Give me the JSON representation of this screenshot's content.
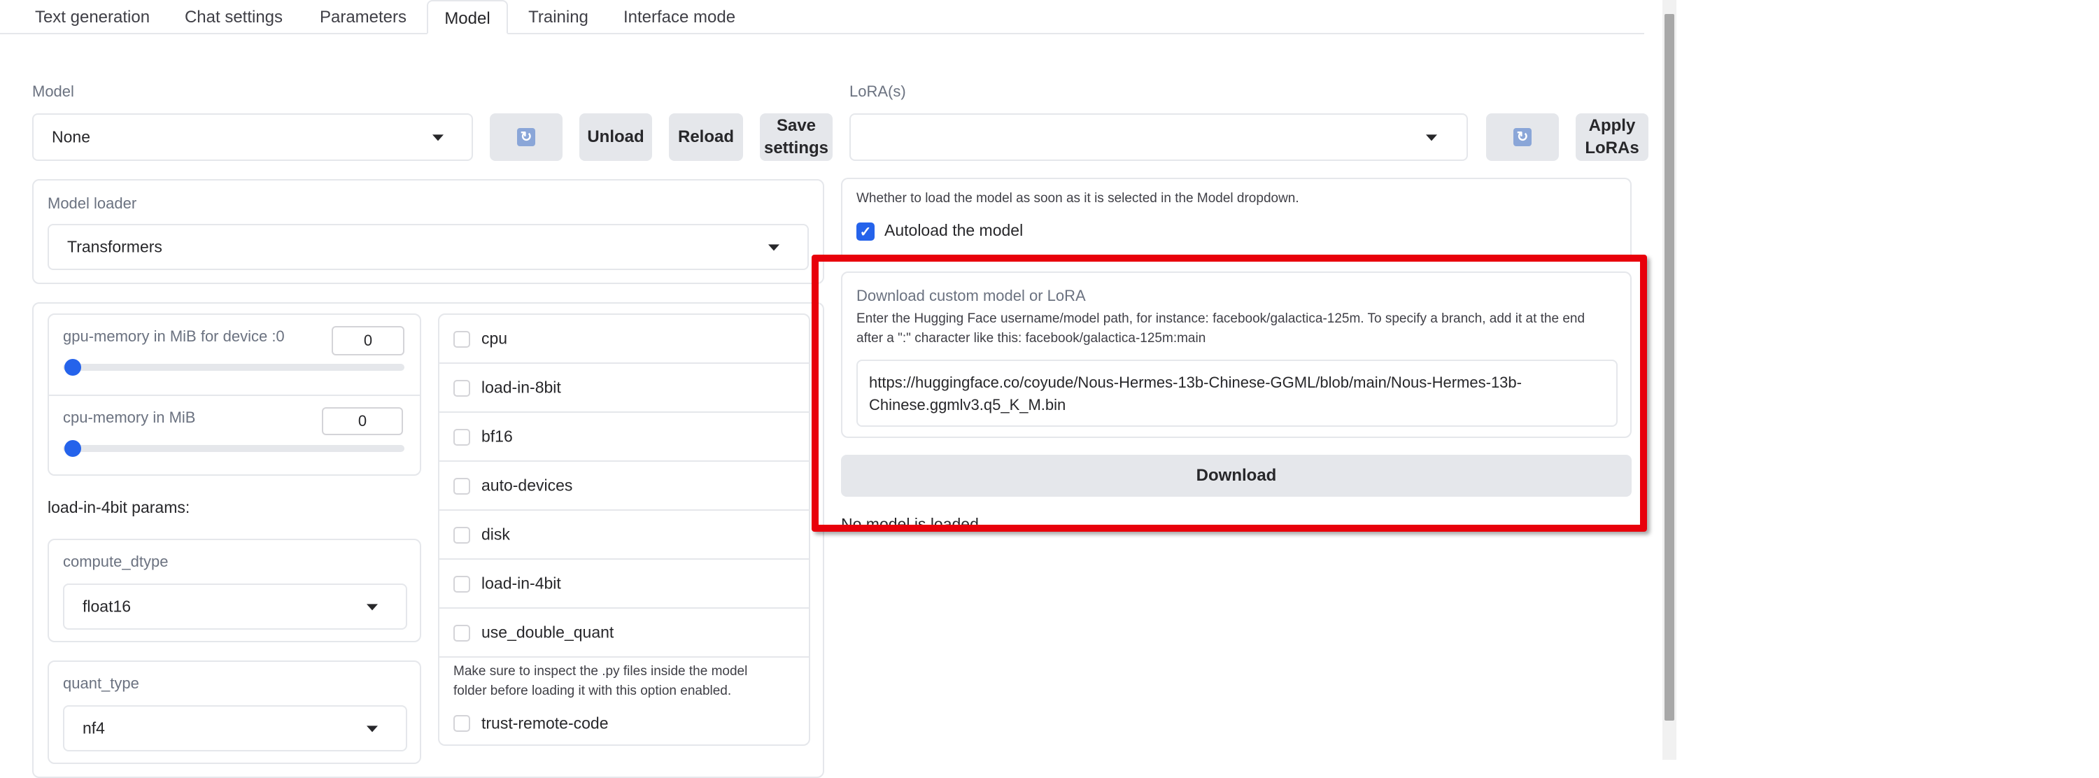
{
  "tabs": [
    {
      "label": "Text generation"
    },
    {
      "label": "Chat settings"
    },
    {
      "label": "Parameters"
    },
    {
      "label": "Model"
    },
    {
      "label": "Training"
    },
    {
      "label": "Interface mode"
    }
  ],
  "model": {
    "label": "Model",
    "selected": "None",
    "unload_label": "Unload",
    "reload_label": "Reload",
    "save_label_line1": "Save",
    "save_label_line2": "settings"
  },
  "lora": {
    "label": "LoRA(s)",
    "selected": "",
    "apply_label_line1": "Apply",
    "apply_label_line2": "LoRAs"
  },
  "loader": {
    "label": "Model loader",
    "selected": "Transformers"
  },
  "gpu_memory": {
    "label": "gpu-memory in MiB for device :0",
    "value": "0",
    "level": 0
  },
  "cpu_memory": {
    "label": "cpu-memory in MiB",
    "value": "0",
    "level": 0
  },
  "fourbit": {
    "heading": "load-in-4bit params:",
    "compute_dtype_label": "compute_dtype",
    "compute_dtype_value": "float16",
    "quant_type_label": "quant_type",
    "quant_type_value": "nf4"
  },
  "checkboxes": [
    {
      "label": "cpu",
      "checked": false
    },
    {
      "label": "load-in-8bit",
      "checked": false
    },
    {
      "label": "bf16",
      "checked": false
    },
    {
      "label": "auto-devices",
      "checked": false
    },
    {
      "label": "disk",
      "checked": false
    },
    {
      "label": "load-in-4bit",
      "checked": false
    },
    {
      "label": "use_double_quant",
      "checked": false
    }
  ],
  "trust_note_line1": "Make sure to inspect the .py files inside the model",
  "trust_note_line2": "folder before loading it with this option enabled.",
  "trust_remote_code": {
    "label": "trust-remote-code",
    "checked": false
  },
  "autoload": {
    "info": "Whether to load the model as soon as it is selected in the Model dropdown.",
    "label": "Autoload the model",
    "checked": true
  },
  "download": {
    "title": "Download custom model or LoRA",
    "help_line1": "Enter the Hugging Face username/model path, for instance: facebook/galactica-125m. To specify a branch, add it at the end",
    "help_line2": "after a \":\" character like this: facebook/galactica-125m:main",
    "url_line1": "https://huggingface.co/coyude/Nous-Hermes-13b-Chinese-GGML/blob/main/Nous-Hermes-13b-",
    "url_line2": "Chinese.ggmlv3.q5_K_M.bin",
    "button_label": "Download",
    "status_partial": "No model is loaded"
  },
  "colors": {
    "accent": "#2563eb",
    "highlight_box": "#e8000b",
    "button_bg": "#e5e7eb",
    "border": "#e5e7eb"
  },
  "icons": {
    "refresh": "refresh-icon",
    "dropdown": "chevron-down-icon",
    "check": "checkmark-icon"
  }
}
